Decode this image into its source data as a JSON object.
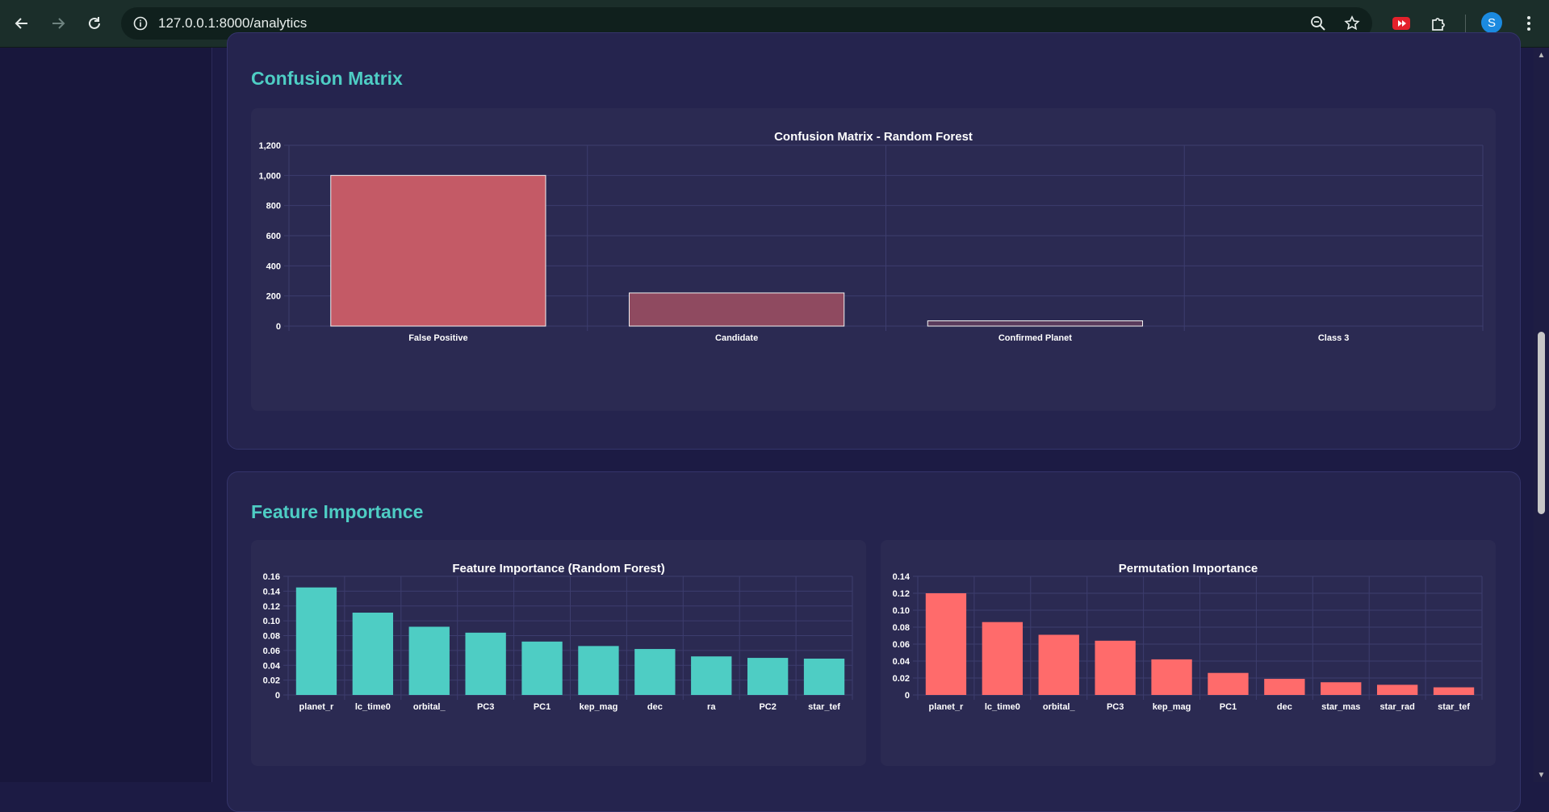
{
  "browser": {
    "url": "127.0.0.1:8000/analytics",
    "avatar_letter": "S"
  },
  "colors": {
    "accent": "#4ecdc4",
    "bar_red": "#ff6b6b",
    "teal": "#4ecdc4"
  },
  "icons": {
    "back": "back-arrow-icon",
    "forward": "forward-arrow-icon",
    "reload": "reload-icon",
    "info": "info-icon",
    "zoom": "zoom-icon",
    "bookmark": "star-icon",
    "extension_red": "youtube-extension-icon",
    "extensions": "puzzle-icon",
    "menu": "kebab-menu-icon"
  },
  "sections": {
    "confusion": {
      "title": "Confusion Matrix"
    },
    "feature": {
      "title": "Feature Importance"
    }
  },
  "chart_data": [
    {
      "type": "bar",
      "title": "Confusion Matrix - Random Forest",
      "categories": [
        "False Positive",
        "Candidate",
        "Confirmed Planet",
        "Class 3"
      ],
      "values": [
        1000,
        220,
        35,
        0
      ],
      "colors": [
        "#c45a66",
        "#8f4a60",
        "#5a3b5c",
        "#4a3a5c"
      ],
      "yticks": [
        "0",
        "200",
        "400",
        "600",
        "800",
        "1,000",
        "1,200"
      ],
      "ylim": [
        0,
        1200
      ],
      "grid": true
    },
    {
      "type": "bar",
      "title": "Feature Importance (Random Forest)",
      "categories": [
        "planet_r",
        "lc_time0",
        "orbital_",
        "PC3",
        "PC1",
        "kep_mag",
        "dec",
        "ra",
        "PC2",
        "star_tef"
      ],
      "values": [
        0.145,
        0.111,
        0.092,
        0.084,
        0.072,
        0.066,
        0.062,
        0.052,
        0.05,
        0.049
      ],
      "yticks": [
        "0",
        "0.02",
        "0.04",
        "0.06",
        "0.08",
        "0.10",
        "0.12",
        "0.14",
        "0.16"
      ],
      "ylim": [
        0,
        0.16
      ],
      "color": "#4ecdc4",
      "grid": true
    },
    {
      "type": "bar",
      "title": "Permutation Importance",
      "categories": [
        "planet_r",
        "lc_time0",
        "orbital_",
        "PC3",
        "kep_mag",
        "PC1",
        "dec",
        "star_mas",
        "star_rad",
        "star_tef"
      ],
      "values": [
        0.12,
        0.086,
        0.071,
        0.064,
        0.042,
        0.026,
        0.019,
        0.015,
        0.012,
        0.009
      ],
      "yticks": [
        "0",
        "0.02",
        "0.04",
        "0.06",
        "0.08",
        "0.10",
        "0.12",
        "0.14"
      ],
      "ylim": [
        0,
        0.14
      ],
      "color": "#ff6b6b",
      "grid": true
    }
  ]
}
